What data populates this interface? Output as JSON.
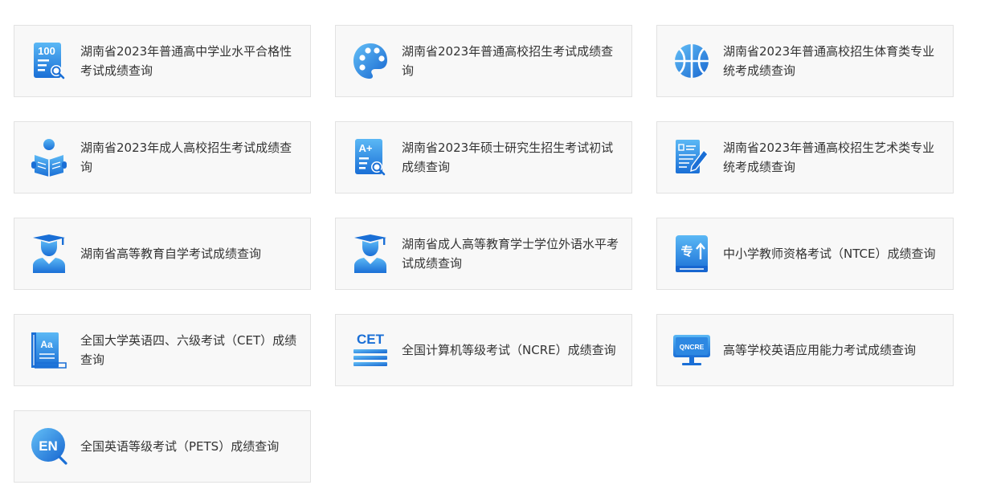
{
  "colors": {
    "icon_light": "#5bb8f5",
    "icon_dark": "#1a6fd6",
    "card_bg": "#f8f8f8",
    "card_border": "#e2e2e2",
    "text": "#333333"
  },
  "cards": [
    {
      "label": "湖南省2023年普通高中学业水平合格性考试成绩查询",
      "icon": "score-100-search-icon"
    },
    {
      "label": "湖南省2023年普通高校招生考试成绩查询",
      "icon": "palette-icon"
    },
    {
      "label": "湖南省2023年普通高校招生体育类专业统考成绩查询",
      "icon": "basketball-icon"
    },
    {
      "label": "湖南省2023年成人高校招生考试成绩查询",
      "icon": "reader-icon"
    },
    {
      "label": "湖南省2023年硕士研究生招生考试初试成绩查询",
      "icon": "grade-a-search-icon"
    },
    {
      "label": "湖南省2023年普通高校招生艺术类专业统考成绩查询",
      "icon": "document-pen-icon"
    },
    {
      "label": "湖南省高等教育自学考试成绩查询",
      "icon": "graduate-icon"
    },
    {
      "label": "湖南省成人高等教育学士学位外语水平考试成绩查询",
      "icon": "graduate-icon"
    },
    {
      "label": "中小学教师资格考试（NTCE）成绩查询",
      "icon": "specialty-book-icon"
    },
    {
      "label": "全国大学英语四、六级考试（CET）成绩查询",
      "icon": "book-aa-icon"
    },
    {
      "label": "全国计算机等级考试（NCRE）成绩查询",
      "icon": "cet-list-icon"
    },
    {
      "label": "高等学校英语应用能力考试成绩查询",
      "icon": "qncre-monitor-icon"
    },
    {
      "label": "全国英语等级考试（PETS）成绩查询",
      "icon": "en-search-icon"
    }
  ],
  "icon_text": {
    "score": "100",
    "grade": "A+",
    "cet": "CET",
    "qncre": "QNCRE",
    "en": "EN",
    "specialty": "专"
  }
}
